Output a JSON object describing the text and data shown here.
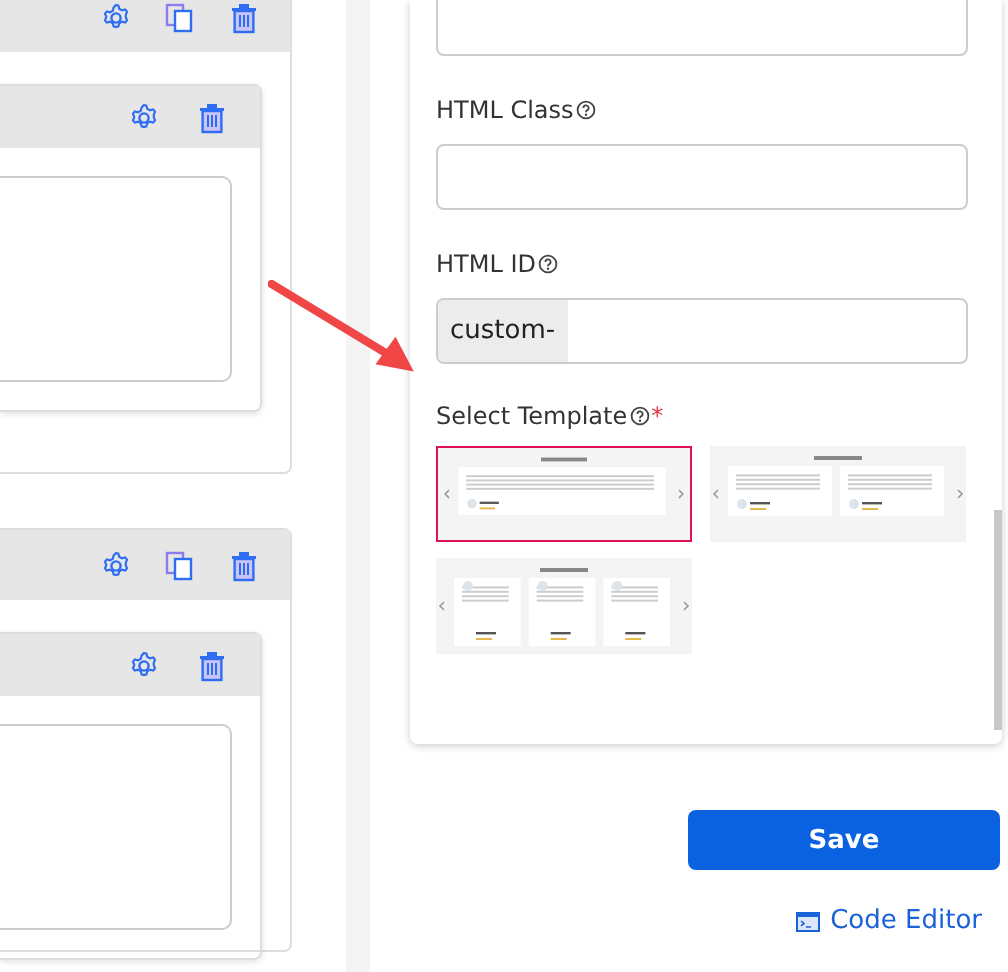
{
  "blocks": [
    {
      "actions": [
        {
          "kind": "settings"
        },
        {
          "kind": "copy"
        },
        {
          "kind": "delete"
        }
      ],
      "inner": {
        "actions": [
          {
            "kind": "settings"
          },
          {
            "kind": "delete"
          }
        ]
      }
    },
    {
      "actions": [
        {
          "kind": "settings"
        },
        {
          "kind": "copy"
        },
        {
          "kind": "delete"
        }
      ],
      "inner": {
        "actions": [
          {
            "kind": "settings"
          },
          {
            "kind": "delete"
          }
        ]
      }
    }
  ],
  "form": {
    "fields": [
      {
        "label": "HTML Class"
      },
      {
        "label": "HTML ID",
        "prefix": "custom-"
      }
    ],
    "template_label": "Select Template",
    "required_mark": "*",
    "templates": [
      {
        "kind": "single",
        "selected": true
      },
      {
        "kind": "double",
        "selected": false
      },
      {
        "kind": "triple",
        "selected": false
      }
    ],
    "save": "Save",
    "code_editor": "Code Editor"
  }
}
